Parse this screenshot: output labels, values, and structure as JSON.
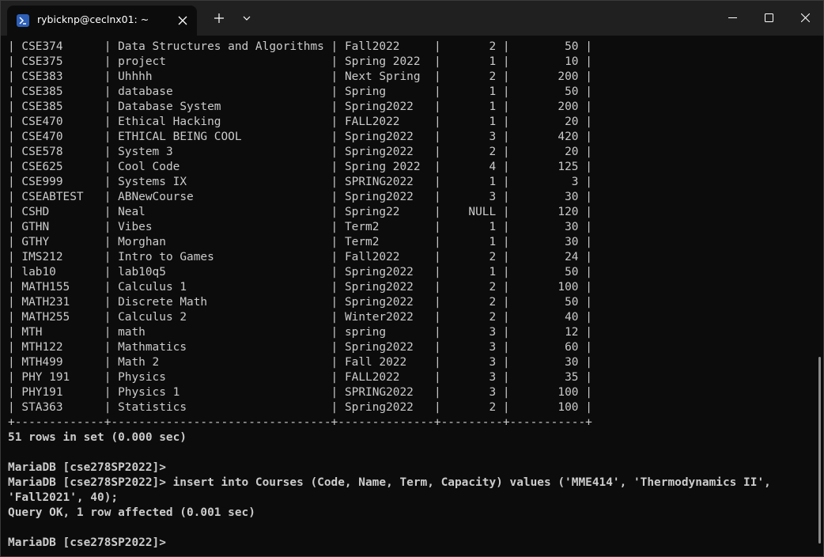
{
  "titlebar": {
    "tab_title": "rybicknp@ceclnx01: ~"
  },
  "icons": {
    "tab": "powershell-icon",
    "close_tab": "close-icon",
    "new_tab": "plus-icon",
    "dropdown": "chevron-down-icon",
    "minimize": "minimize-icon",
    "maximize": "maximize-icon",
    "close_window": "close-icon"
  },
  "colors": {
    "titlebar_bg": "#202020",
    "terminal_bg": "#0c0c0c",
    "text": "#cccccc"
  },
  "table": {
    "rows": [
      [
        "CSE374",
        "Data Structures and Algorithms",
        "Fall2022",
        "2",
        "50"
      ],
      [
        "CSE375",
        "project",
        "Spring 2022",
        "1",
        "10"
      ],
      [
        "CSE383",
        "Uhhhh",
        "Next Spring",
        "2",
        "200"
      ],
      [
        "CSE385",
        "database",
        "Spring",
        "1",
        "50"
      ],
      [
        "CSE385",
        "Database System",
        "Spring2022",
        "1",
        "200"
      ],
      [
        "CSE470",
        "Ethical Hacking",
        "FALL2022",
        "1",
        "20"
      ],
      [
        "CSE470",
        "ETHICAL BEING COOL",
        "Spring2022",
        "3",
        "420"
      ],
      [
        "CSE578",
        "System 3",
        "Spring2022",
        "2",
        "20"
      ],
      [
        "CSE625",
        "Cool Code",
        "Spring 2022",
        "4",
        "125"
      ],
      [
        "CSE999",
        "Systems IX",
        "SPRING2022",
        "1",
        "3"
      ],
      [
        "CSEABTEST",
        "ABNewCourse",
        "Spring2022",
        "3",
        "30"
      ],
      [
        "CSHD",
        "Neal",
        "Spring22",
        "NULL",
        "120"
      ],
      [
        "GTHN",
        "Vibes",
        "Term2",
        "1",
        "30"
      ],
      [
        "GTHY",
        "Morghan",
        "Term2",
        "1",
        "30"
      ],
      [
        "IMS212",
        "Intro to Games",
        "Fall2022",
        "2",
        "24"
      ],
      [
        "lab10",
        "lab10q5",
        "Spring2022",
        "1",
        "50"
      ],
      [
        "MATH155",
        "Calculus 1",
        "Spring2022",
        "2",
        "100"
      ],
      [
        "MATH231",
        "Discrete Math",
        "Spring2022",
        "2",
        "50"
      ],
      [
        "MATH255",
        "Calculus 2",
        "Winter2022",
        "2",
        "40"
      ],
      [
        "MTH",
        "math",
        "spring",
        "3",
        "12"
      ],
      [
        "MTH122",
        "Mathmatics",
        "Spring2022",
        "3",
        "60"
      ],
      [
        "MTH499",
        "Math 2",
        "Fall 2022",
        "3",
        "30"
      ],
      [
        "PHY 191",
        "Physics",
        "FALL2022",
        "3",
        "35"
      ],
      [
        "PHY191",
        "Physics 1",
        "SPRING2022",
        "3",
        "100"
      ],
      [
        "STA363",
        "Statistics",
        "Spring2022",
        "2",
        "100"
      ]
    ],
    "col_widths": [
      11,
      30,
      12,
      7,
      9
    ],
    "right_align": [
      false,
      false,
      false,
      true,
      true
    ]
  },
  "session": {
    "rowcount": "51 rows in set (0.000 sec)",
    "blank1": "",
    "prompt1": "MariaDB [cse278SP2022]>",
    "command_line1": "MariaDB [cse278SP2022]> insert into Courses (Code, Name, Term, Capacity) values ('MME414', 'Thermodynamics II',",
    "command_line2": "'Fall2021', 40);",
    "query_ok": "Query OK, 1 row affected (0.001 sec)",
    "blank2": "",
    "prompt2": "MariaDB [cse278SP2022]>"
  }
}
